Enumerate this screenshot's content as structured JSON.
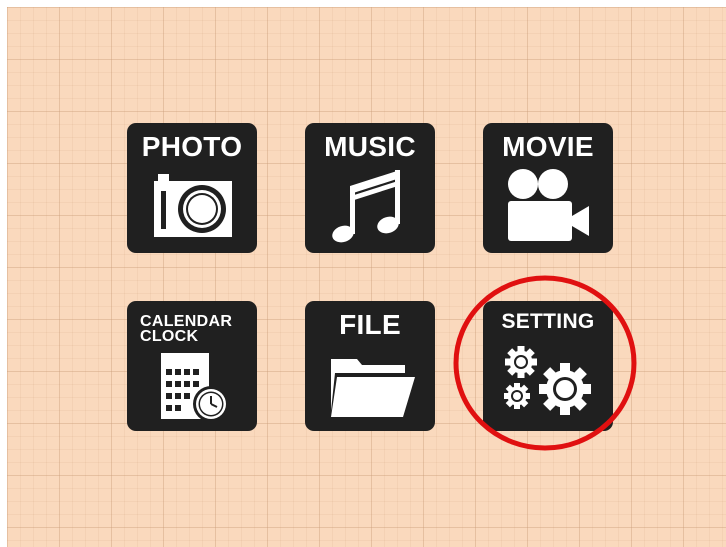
{
  "menu": {
    "tiles": [
      {
        "id": "photo",
        "label": "PHOTO",
        "icon": "camera-icon"
      },
      {
        "id": "music",
        "label": "MUSIC",
        "icon": "music-note-icon"
      },
      {
        "id": "movie",
        "label": "MOVIE",
        "icon": "movie-camera-icon"
      },
      {
        "id": "calendar-clock",
        "label_line1": "CALENDAR",
        "label_line2": "CLOCK",
        "icon": "calendar-clock-icon"
      },
      {
        "id": "file",
        "label": "FILE",
        "icon": "folder-icon"
      },
      {
        "id": "setting",
        "label": "SETTING",
        "icon": "gears-icon"
      }
    ]
  },
  "highlight": {
    "target": "setting",
    "color": "#e01010"
  },
  "colors": {
    "background": "#fad9bd",
    "tile": "#202020",
    "icon": "#ffffff"
  }
}
